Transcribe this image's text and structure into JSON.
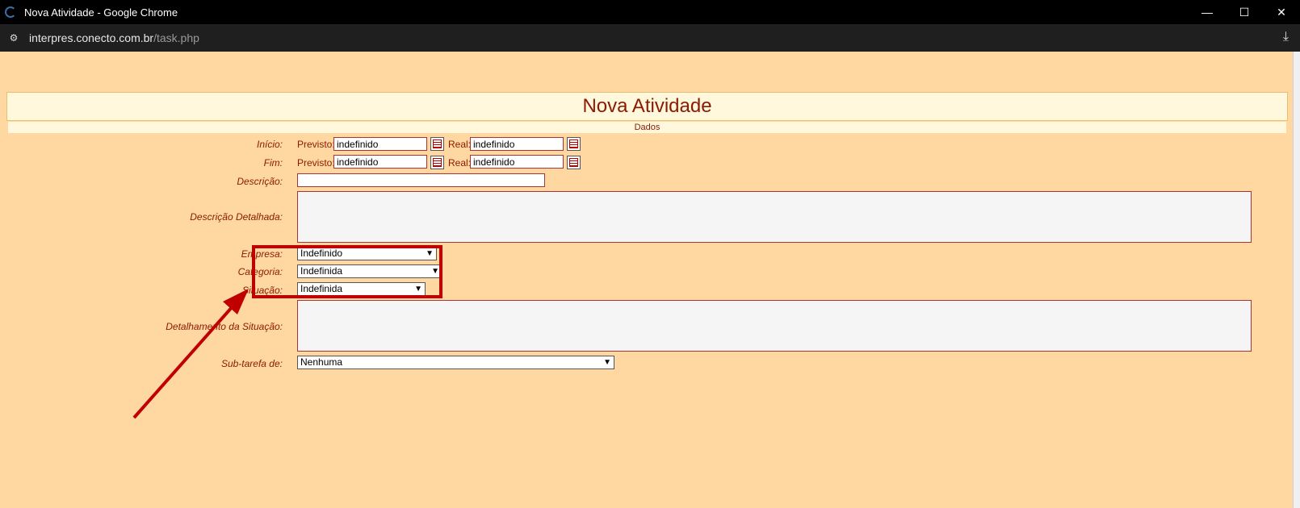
{
  "window": {
    "title": "Nova Atividade - Google Chrome",
    "minimize": "—",
    "maximize": "☐",
    "close": "✕"
  },
  "address": {
    "host": "interpres.conecto.com.br",
    "path": "/task.php"
  },
  "page": {
    "title": "Nova Atividade",
    "section": "Dados"
  },
  "form": {
    "inicio_label": "Início:",
    "fim_label": "Fim:",
    "previsto_label": "Previsto:",
    "real_label": "Real:",
    "inicio_previsto": "indefinido",
    "inicio_real": "indefinido",
    "fim_previsto": "indefinido",
    "fim_real": "indefinido",
    "descricao_label": "Descrição:",
    "descricao_value": "",
    "descricao_detalhada_label": "Descrição Detalhada:",
    "empresa_label": "Empresa:",
    "empresa_value": "Indefinido",
    "categoria_label": "Categoria:",
    "categoria_value": "Indefinida",
    "situacao_label": "Situação:",
    "situacao_value": "Indefinida",
    "detalhamento_label": "Detalhamento da Situação:",
    "subtarefa_label": "Sub-tarefa de:",
    "subtarefa_value": "Nenhuma"
  },
  "colors": {
    "page_bg": "#ffd7a0",
    "accent": "#8b1a00",
    "highlight": "#c00000"
  },
  "icons": [
    "calendar-icon",
    "download-icon",
    "site-settings-icon"
  ]
}
